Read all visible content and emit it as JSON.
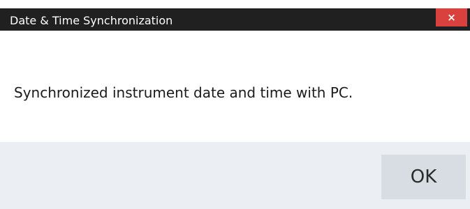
{
  "window": {
    "title": "Date & Time Synchronization",
    "close_icon": "close-icon",
    "close_glyph": "×",
    "close_color": "#d9413e"
  },
  "body": {
    "message": "Synchronized instrument date and time with PC."
  },
  "footer": {
    "ok_label": "OK"
  }
}
